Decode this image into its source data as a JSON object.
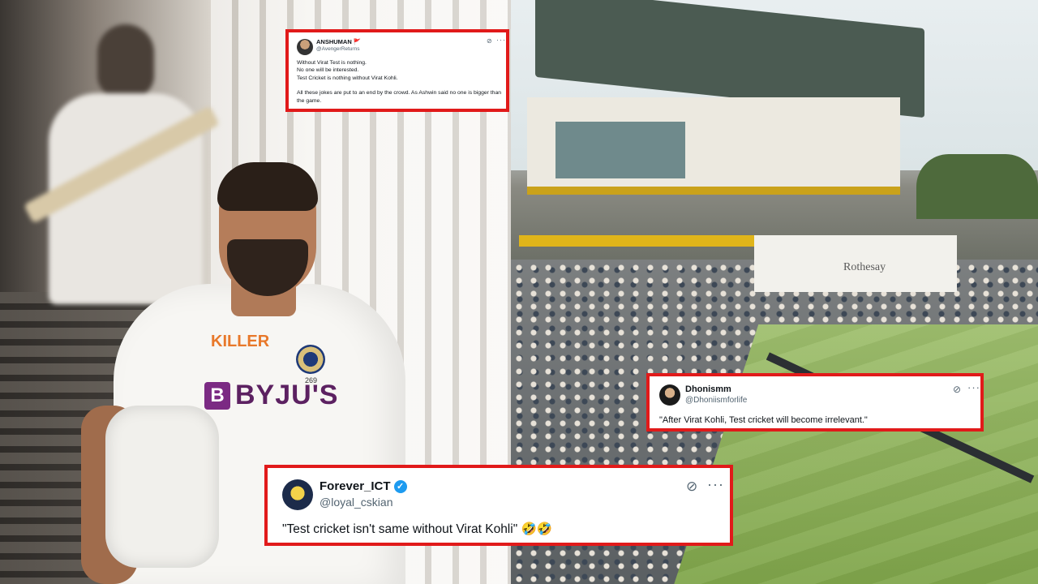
{
  "left_photo": {
    "jersey_brand": "KILLER",
    "jersey_number": "269",
    "sponsor_mark": "B",
    "sponsor_text": "BYJU'S"
  },
  "right_photo": {
    "pavilion_sign": "Rothesay"
  },
  "tweets": [
    {
      "name": "ANSHUMAN 🚩",
      "handle": "@AvengerReturns",
      "lines": [
        "Without Virat Test is nothing.",
        "No one will be interested.",
        "Test Cricket is nothing without Virat Kohli.",
        "",
        "All these jokes are put to an end by the crowd. As Ashwin said no one is bigger than the game."
      ],
      "grok_icon": "⊘",
      "more_icon": "···"
    },
    {
      "name": "Dhonismm",
      "handle": "@Dhoniismforlife",
      "text": "\"After Virat Kohli, Test cricket will become irrelevant.\"",
      "grok_icon": "⊘",
      "more_icon": "···"
    },
    {
      "name": "Forever_ICT",
      "handle": "@loyal_cskian",
      "verified": "✓",
      "text": "\"Test cricket isn't same without Virat Kohli\" 🤣🤣",
      "grok_icon": "⊘",
      "more_icon": "···"
    }
  ],
  "colors": {
    "card_border": "#e11a1a",
    "verified": "#1d9bf0"
  }
}
